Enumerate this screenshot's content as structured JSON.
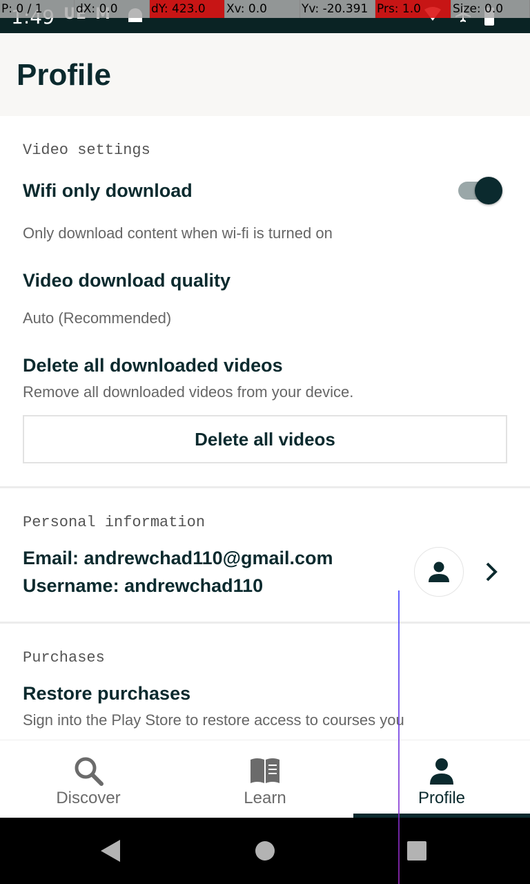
{
  "status_bar": {
    "time": "1:49",
    "notifications": [
      "UE",
      "M",
      "android-icon"
    ],
    "right_icons": [
      "wifi-icon",
      "airplane-icon",
      "battery-icon"
    ]
  },
  "debug_overlay": {
    "p": "P: 0 / 1",
    "dx": "dX: 0.0",
    "dy": "dY: 423.0",
    "xv": "Xv: 0.0",
    "yv": "Yv: -20.391",
    "prs": "Prs: 1.0",
    "size": "Size: 0.0"
  },
  "app_bar": {
    "title": "Profile"
  },
  "video_settings": {
    "label": "Video settings",
    "wifi_title": "Wifi only download",
    "wifi_sub": "Only download content when wi-fi is turned on",
    "wifi_enabled": true,
    "quality_title": "Video download quality",
    "quality_value": "Auto (Recommended)",
    "delete_title": "Delete all downloaded videos",
    "delete_sub": "Remove all downloaded videos from your device.",
    "delete_button": "Delete all videos"
  },
  "personal_info": {
    "label": "Personal information",
    "email": "Email: andrewchad110@gmail.com",
    "username": "Username: andrewchad110"
  },
  "purchases": {
    "label": "Purchases",
    "restore_title": "Restore purchases",
    "restore_sub": "Sign into the Play Store to restore access to courses you"
  },
  "bottom_nav": {
    "items": [
      {
        "label": "Discover",
        "icon": "search-icon"
      },
      {
        "label": "Learn",
        "icon": "book-icon"
      },
      {
        "label": "Profile",
        "icon": "person-icon",
        "active": true
      }
    ]
  },
  "colors": {
    "primary": "#0b2a2e",
    "status_bar": "#0a2324",
    "app_bar_bg": "#f8f7f5"
  }
}
